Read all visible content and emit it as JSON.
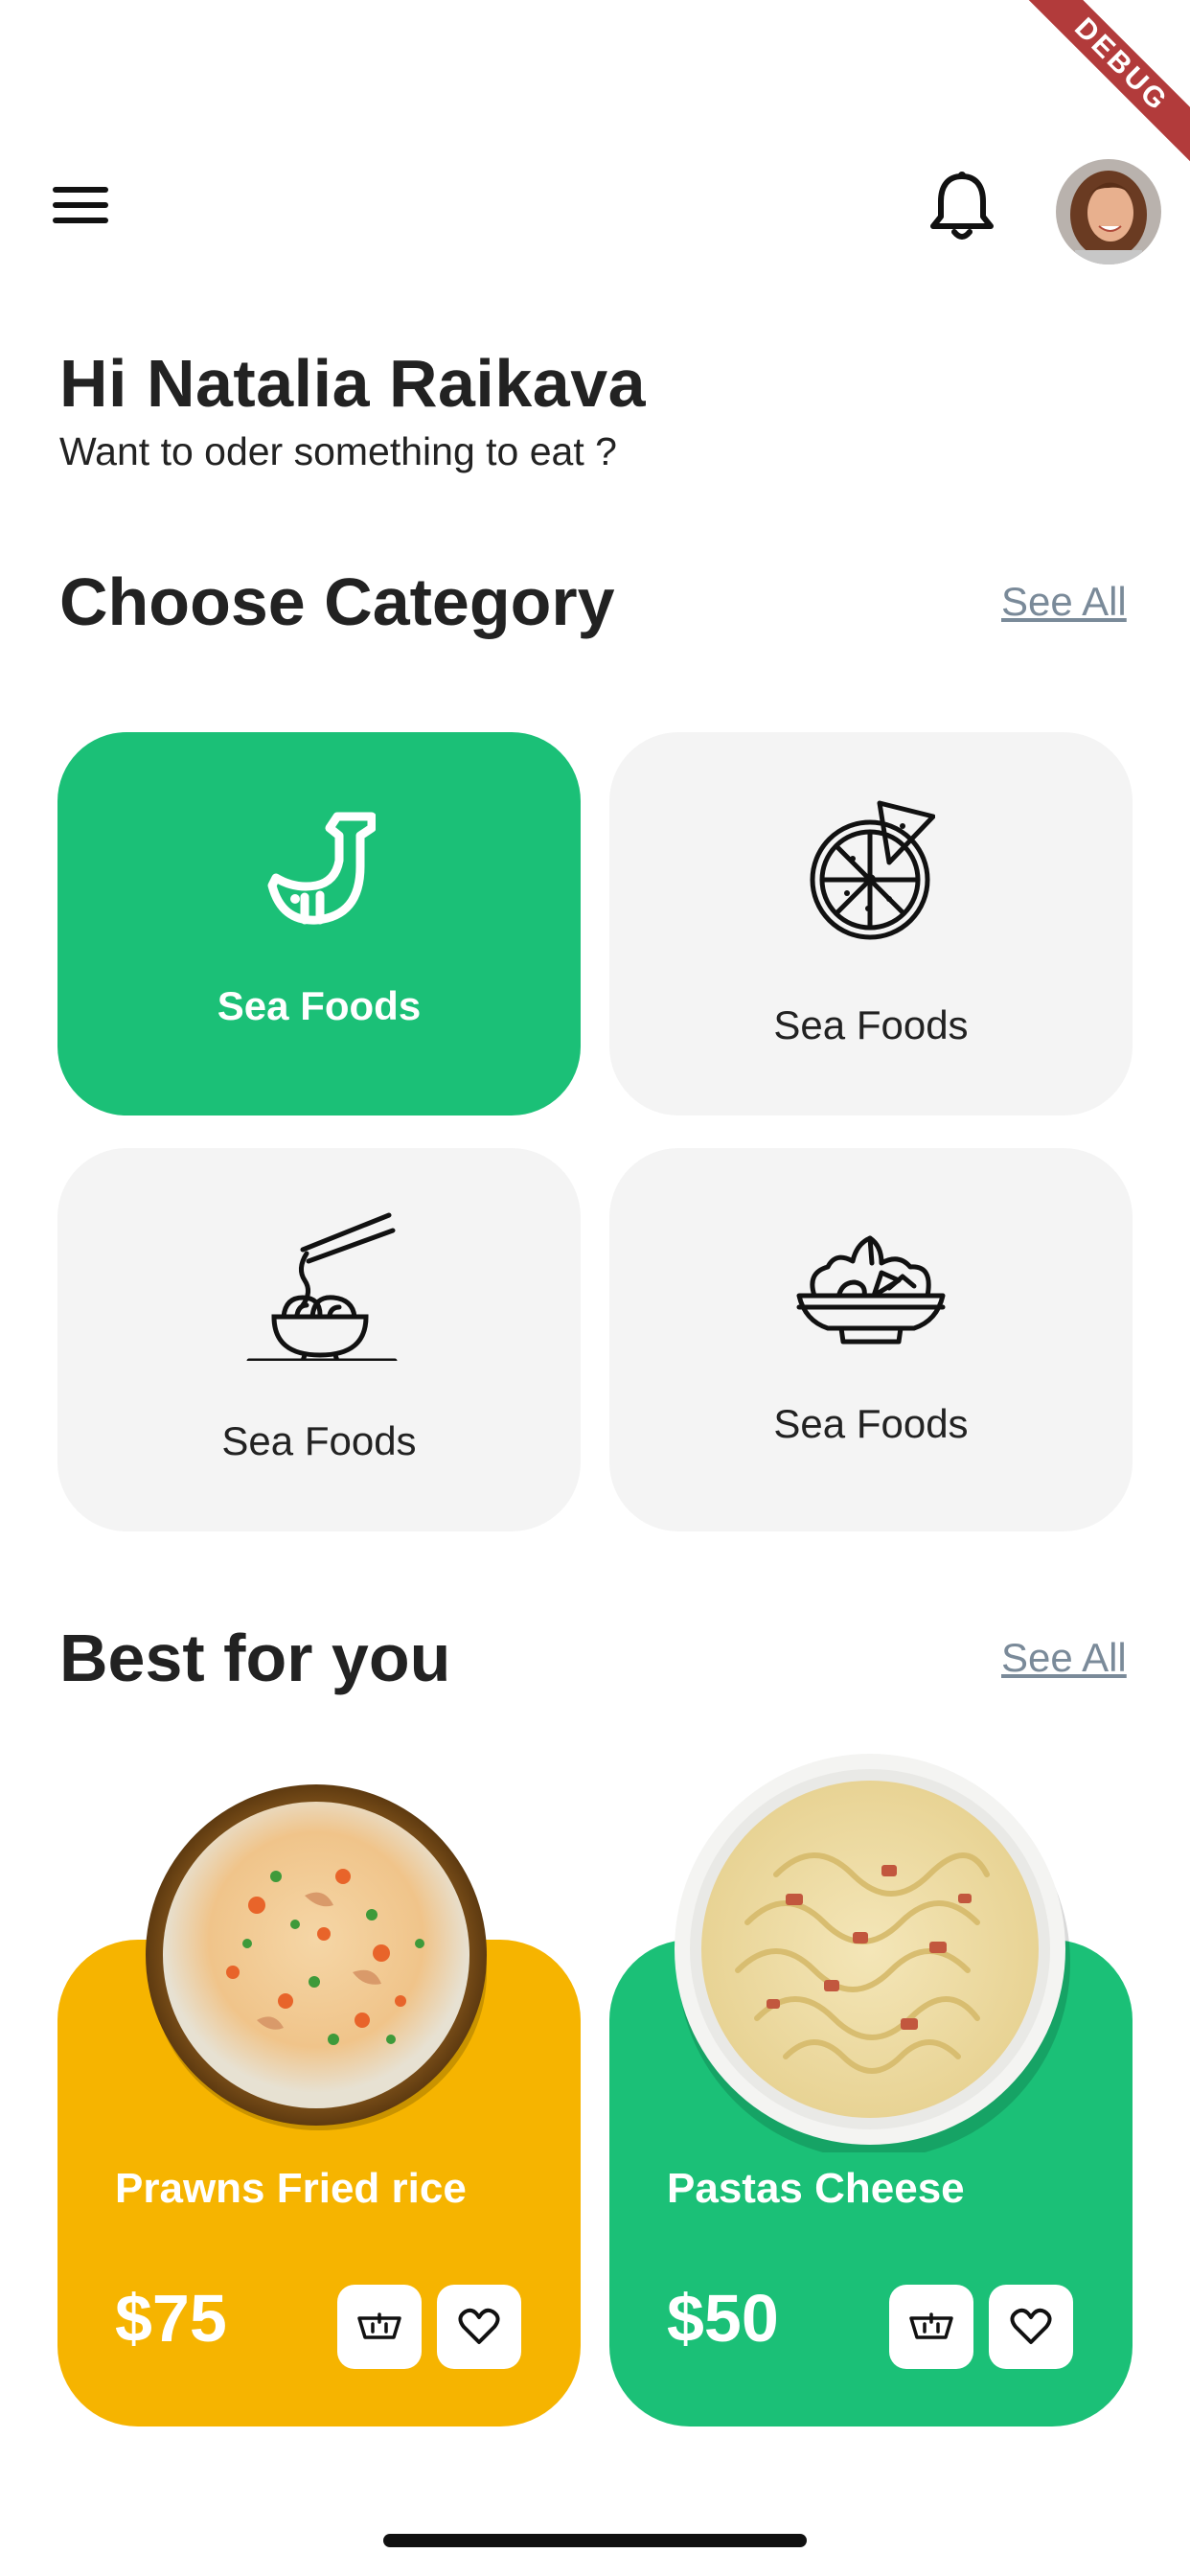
{
  "debug_banner": "DEBUG",
  "header": {
    "menu_icon": "hamburger-icon",
    "bell_icon": "bell-icon",
    "avatar": "user-avatar"
  },
  "greeting": {
    "title": "Hi Natalia Raikava",
    "subtitle": "Want to oder something to eat ?"
  },
  "categories": {
    "title": "Choose Category",
    "see_all": "See All",
    "items": [
      {
        "label": "Sea Foods",
        "icon": "whale-icon",
        "active": true
      },
      {
        "label": "Sea Foods",
        "icon": "pizza-icon",
        "active": false
      },
      {
        "label": "Sea Foods",
        "icon": "noodles-icon",
        "active": false
      },
      {
        "label": "Sea Foods",
        "icon": "salad-icon",
        "active": false
      }
    ]
  },
  "best": {
    "title": "Best for you",
    "see_all": "See All",
    "items": [
      {
        "name": "Prawns Fried rice",
        "price": "$75",
        "color": "#f6b400",
        "image": "fried-rice-plate"
      },
      {
        "name": "Pastas Cheese",
        "price": "$50",
        "color": "#1bc077",
        "image": "pasta-bowl"
      }
    ]
  },
  "colors": {
    "accent_green": "#1bc077",
    "accent_yellow": "#f6b400",
    "card_gray": "#f4f4f4",
    "link_gray": "#7a8a99"
  }
}
